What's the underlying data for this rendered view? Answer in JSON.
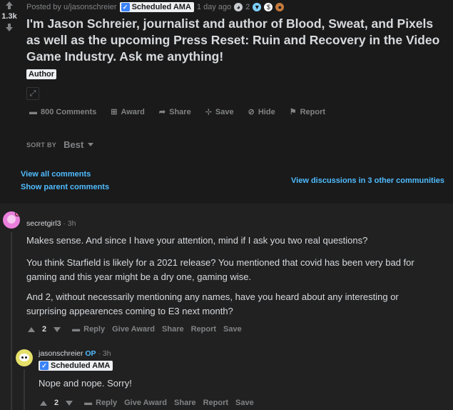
{
  "post": {
    "score": "1.3k",
    "posted_by": "Posted by u/jasonschreier",
    "flair": "Scheduled AMA",
    "age": "1 day ago",
    "award_count": "2",
    "title": "I'm Jason Schreier, journalist and author of Blood, Sweat, and Pixels as well as the upcoming Press Reset: Ruin and Recovery in the Video Game Industry. Ask me anything!",
    "author_tag": "Author",
    "actions": {
      "comments": "800 Comments",
      "award": "Award",
      "share": "Share",
      "save": "Save",
      "hide": "Hide",
      "report": "Report"
    }
  },
  "sort": {
    "label": "SORT BY",
    "value": "Best"
  },
  "links": {
    "view_all": "View all comments",
    "show_parent": "Show parent comments",
    "view_discussions": "View discussions in 3 other communities"
  },
  "comments": [
    {
      "author": "secretgirl3",
      "age": "3h",
      "paragraphs": [
        "Makes sense. And since I have your attention, mind if I ask you two real questions?",
        "You think Starfield is likely for a 2021 release? You mentioned that covid has been very bad for gaming and this year might be a dry one, gaming wise.",
        "And 2, without necessarily mentioning any names, have you heard about any interesting or surprising appearences coming to E3 next month?"
      ],
      "score": "2",
      "actions": {
        "reply": "Reply",
        "give_award": "Give Award",
        "share": "Share",
        "report": "Report",
        "save": "Save"
      }
    },
    {
      "author": "jasonschreier",
      "op": "OP",
      "age": "3h",
      "flair": "Scheduled AMA",
      "paragraphs": [
        "Nope and nope. Sorry!"
      ],
      "score": "2",
      "actions": {
        "reply": "Reply",
        "give_award": "Give Award",
        "share": "Share",
        "report": "Report",
        "save": "Save"
      }
    }
  ],
  "colors": {
    "background": "#1a1a1b",
    "comment_panel": "#212122",
    "link": "#4fbcff",
    "muted": "#818384",
    "flair_check": "#3b83f7"
  }
}
